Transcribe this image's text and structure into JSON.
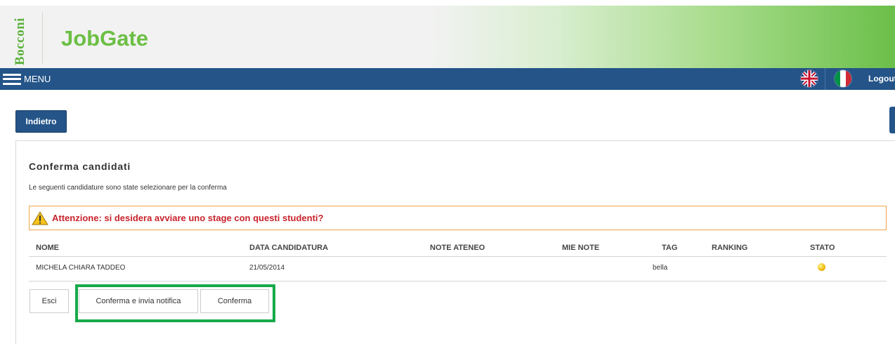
{
  "header": {
    "logo_text": "Bocconi",
    "app_title": "JobGate"
  },
  "navbar": {
    "menu_label": "MENU",
    "languages": [
      "uk-flag-icon",
      "italy-flag-icon"
    ],
    "logout_label": "Logout"
  },
  "back_button": "Indietro",
  "panel": {
    "title": "Conferma candidati",
    "subtitle": "Le seguenti candidature sono state selezionare per la conferma",
    "warning": "Attenzione: si desidera avviare uno stage con questi studenti?"
  },
  "table": {
    "columns": [
      "NOME",
      "DATA CANDIDATURA",
      "NOTE ATENEO",
      "MIE NOTE",
      "TAG",
      "RANKING",
      "STATO"
    ],
    "rows": [
      {
        "nome": "MICHELA CHIARA TADDEO",
        "data": "21/05/2014",
        "note_ateneo": "",
        "mie_note": "",
        "tag": "bella",
        "ranking": "",
        "stato": "yellow-status-icon"
      }
    ]
  },
  "buttons": {
    "esci": "Esci",
    "notify": "Conferma e invia notifica",
    "confirm": "Conferma"
  },
  "colors": {
    "nav_blue": "#245488",
    "brand_green": "#6cbf45",
    "warning_border": "#f0a44a",
    "warning_text": "#c8232c",
    "highlight": "#17a94a"
  }
}
